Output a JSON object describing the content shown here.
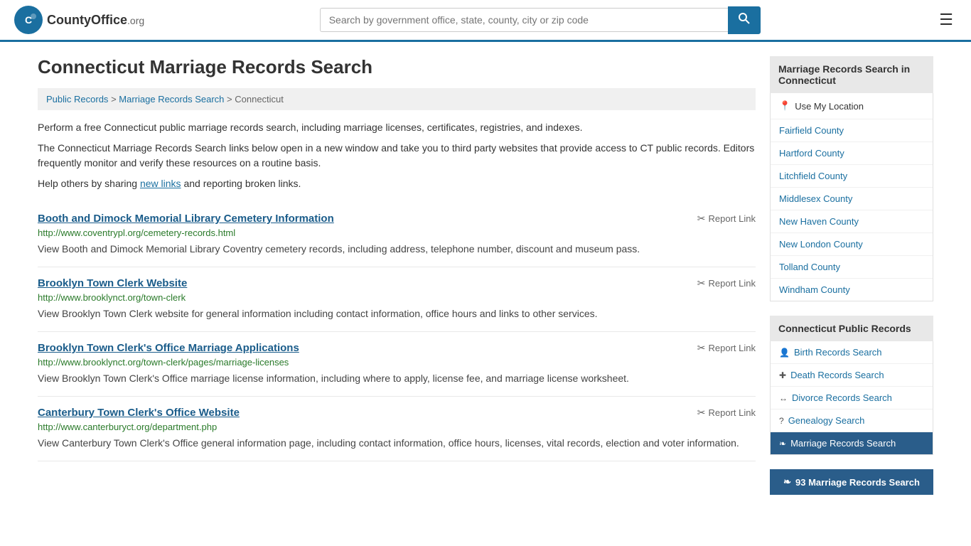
{
  "header": {
    "logo_text": "CountyOffice",
    "logo_org": ".org",
    "search_placeholder": "Search by government office, state, county, city or zip code",
    "menu_label": "☰"
  },
  "page": {
    "title": "Connecticut Marriage Records Search",
    "breadcrumbs": [
      {
        "label": "Public Records",
        "href": "#"
      },
      {
        "label": "Marriage Records Search",
        "href": "#"
      },
      {
        "label": "Connecticut",
        "href": "#"
      }
    ],
    "intro1": "Perform a free Connecticut public marriage records search, including marriage licenses, certificates, registries, and indexes.",
    "intro2": "The Connecticut Marriage Records Search links below open in a new window and take you to third party websites that provide access to CT public records. Editors frequently monitor and verify these resources on a routine basis.",
    "sharing": "Help others by sharing",
    "new_links": "new links",
    "and_reporting": "and reporting broken links."
  },
  "records": [
    {
      "title": "Booth and Dimock Memorial Library Cemetery Information",
      "url": "http://www.coventrypl.org/cemetery-records.html",
      "desc": "View Booth and Dimock Memorial Library Coventry cemetery records, including address, telephone number, discount and museum pass.",
      "report": "Report Link"
    },
    {
      "title": "Brooklyn Town Clerk Website",
      "url": "http://www.brooklynct.org/town-clerk",
      "desc": "View Brooklyn Town Clerk website for general information including contact information, office hours and links to other services.",
      "report": "Report Link"
    },
    {
      "title": "Brooklyn Town Clerk's Office Marriage Applications",
      "url": "http://www.brooklynct.org/town-clerk/pages/marriage-licenses",
      "desc": "View Brooklyn Town Clerk's Office marriage license information, including where to apply, license fee, and marriage license worksheet.",
      "report": "Report Link"
    },
    {
      "title": "Canterbury Town Clerk's Office Website",
      "url": "http://www.canterburyct.org/department.php",
      "desc": "View Canterbury Town Clerk's Office general information page, including contact information, office hours, licenses, vital records, election and voter information.",
      "report": "Report Link"
    }
  ],
  "sidebar": {
    "top_section_title": "Marriage Records Search in Connecticut",
    "use_location": "Use My Location",
    "counties": [
      "Fairfield County",
      "Hartford County",
      "Litchfield County",
      "Middlesex County",
      "New Haven County",
      "New London County",
      "Tolland County",
      "Windham County"
    ],
    "public_records_title": "Connecticut Public Records",
    "public_records": [
      {
        "label": "Birth Records Search",
        "icon": "👤"
      },
      {
        "label": "Death Records Search",
        "icon": "✚"
      },
      {
        "label": "Divorce Records Search",
        "icon": "↔"
      },
      {
        "label": "Genealogy Search",
        "icon": "?"
      },
      {
        "label": "Marriage Records Search",
        "icon": "❧"
      }
    ],
    "bottom_badge": "93 Marriage Records Search"
  }
}
